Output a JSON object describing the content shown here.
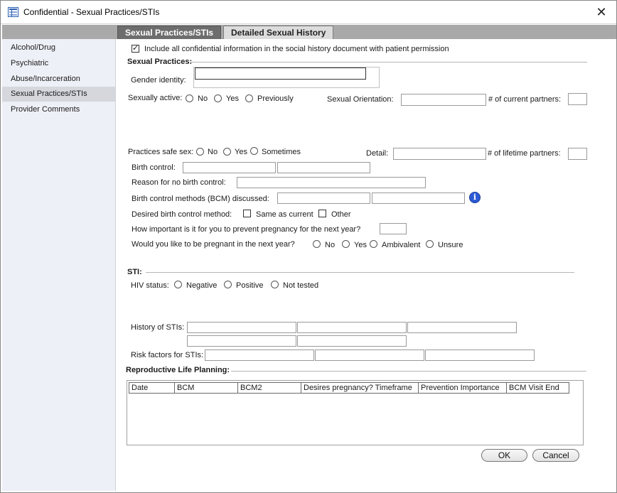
{
  "window": {
    "title": "Confidential - Sexual Practices/STIs",
    "close_glyph": "✕"
  },
  "tabs": [
    {
      "label": "Sexual Practices/STIs"
    },
    {
      "label": "Detailed Sexual History"
    }
  ],
  "sidebar": {
    "items": [
      {
        "label": "Alcohol/Drug"
      },
      {
        "label": "Psychiatric"
      },
      {
        "label": "Abuse/Incarceration"
      },
      {
        "label": "Sexual Practices/STIs"
      },
      {
        "label": "Provider Comments"
      }
    ]
  },
  "include_confidential": {
    "label": "Include all confidential information in the social history document with patient permission",
    "checked": true,
    "check_glyph": "✓"
  },
  "sexual_practices": {
    "heading": "Sexual Practices:",
    "gender_identity_label": "Gender identity:",
    "sexually_active_label": "Sexually active:",
    "sexually_active_options": [
      "No",
      "Yes",
      "Previously"
    ],
    "sexual_orientation_label": "Sexual Orientation:",
    "current_partners_label": "# of current partners:",
    "safe_sex_label": "Practices safe sex:",
    "safe_sex_options": [
      "No",
      "Yes",
      "Sometimes"
    ],
    "detail_label": "Detail:",
    "lifetime_partners_label": "# of lifetime partners:",
    "birth_control_label": "Birth control:",
    "no_birth_control_reason_label": "Reason for no birth control:",
    "bcm_discussed_label": "Birth control methods (BCM) discussed:",
    "desired_bcm_label": "Desired birth control method:",
    "desired_bcm_options": [
      "Same as current",
      "Other"
    ],
    "prevent_pregnancy_label": "How important is it for you to prevent pregnancy for the next year?",
    "pregnant_next_year_label": "Would you like to be pregnant in the next year?",
    "pregnant_next_year_options": [
      "No",
      "Yes",
      "Ambivalent",
      "Unsure"
    ]
  },
  "sti": {
    "heading": "STI:",
    "hiv_status_label": "HIV status:",
    "hiv_status_options": [
      "Negative",
      "Positive",
      "Not tested"
    ],
    "history_label": "History of STIs:",
    "risk_factors_label": "Risk factors for STIs:"
  },
  "reproductive_planning": {
    "heading": "Reproductive Life Planning:",
    "columns": [
      "Date",
      "BCM",
      "BCM2",
      "Desires pregnancy? Timeframe",
      "Prevention Importance",
      "BCM Visit End"
    ]
  },
  "buttons": {
    "ok": "OK",
    "cancel": "Cancel"
  },
  "colors": {
    "info_icon": "#2d5bd6",
    "active_tab": "#6d6d6d",
    "sidebar_bg": "#eef0f7"
  }
}
